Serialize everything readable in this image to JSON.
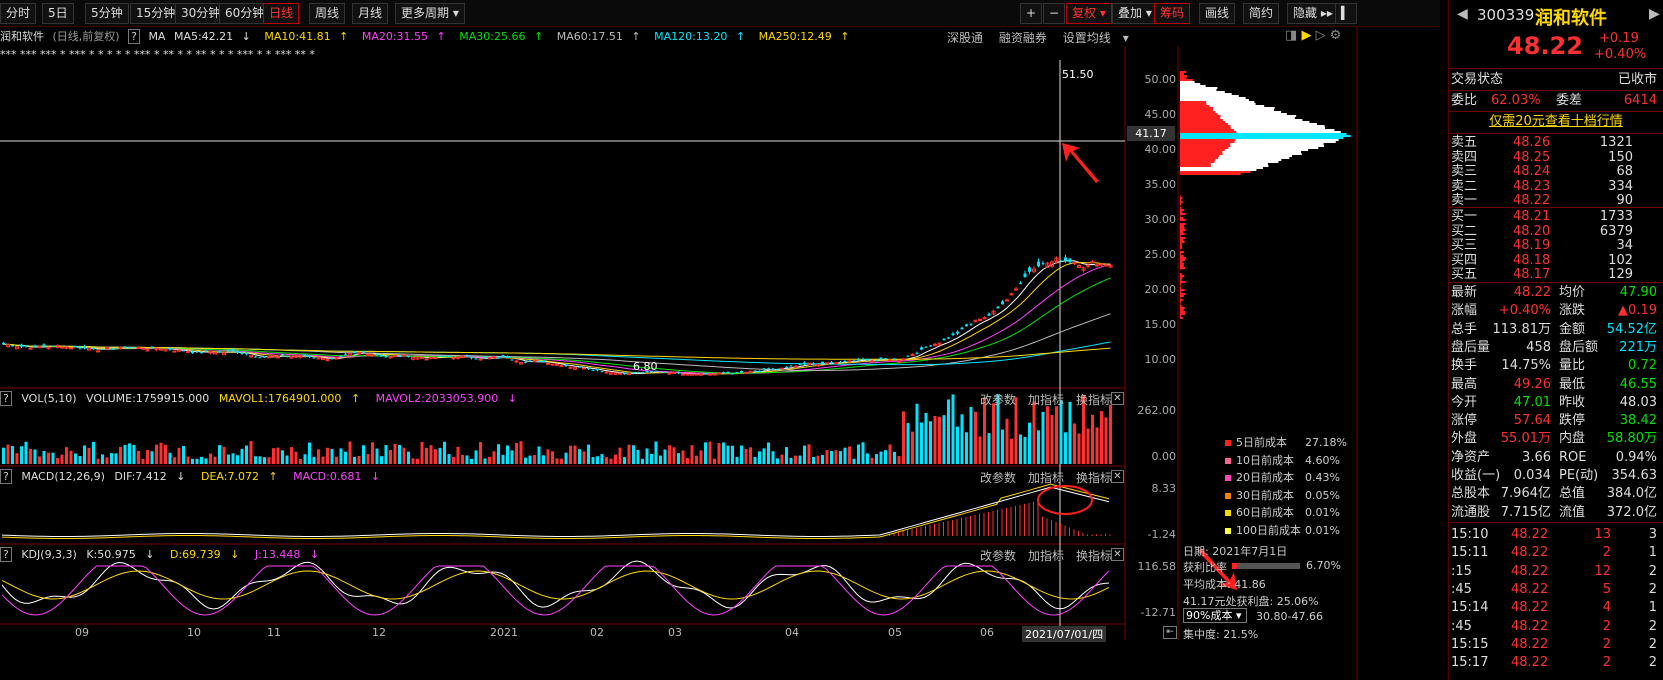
{
  "toolbar": {
    "tabs": [
      "分时",
      "5日",
      "5分钟",
      "15分钟",
      "30分钟",
      "60分钟",
      "日线",
      "周线",
      "月线",
      "更多周期"
    ],
    "right": [
      "+",
      "−",
      "复权",
      "叠加",
      "筹码",
      "画线",
      "简约",
      "隐藏"
    ]
  },
  "ma": {
    "name": "润和软件",
    "mode": "(日线,前复权)",
    "help": "?",
    "label": "MA",
    "ma5": "MA5:42.21",
    "ma10": "MA10:41.81",
    "ma20": "MA20:31.55",
    "ma30": "MA30:25.66",
    "ma60": "MA60:17.51",
    "ma120": "MA120:13.20",
    "ma250": "MA250:12.49"
  },
  "chart_links": [
    "深股通",
    "融资融券",
    "设置均线"
  ],
  "price_axis": [
    "50.00",
    "45.00",
    "40.00",
    "35.00",
    "30.00",
    "25.00",
    "20.00",
    "15.00",
    "10.00"
  ],
  "crosshair_price": "41.17",
  "peak_label": "51.50",
  "low_label": "6.80",
  "vol": {
    "label": "VOL(5,10)",
    "volume": "VOLUME:1759915.000",
    "mavol1": "MAVOL1:1764901.000",
    "mavol2": "MAVOL2:2033053.900",
    "axis_top": "262.00",
    "axis_bottom": "0.00"
  },
  "macd": {
    "label": "MACD(12,26,9)",
    "dif": "DIF:7.412",
    "dea": "DEA:7.072",
    "macd": "MACD:0.681",
    "axis_top": "8.33",
    "axis_bottom": "-1.24"
  },
  "kdj": {
    "label": "KDJ(9,3,3)",
    "k": "K:50.975",
    "d": "D:69.739",
    "j": "J:13.448",
    "axis_top": "116.58",
    "axis_bottom": "-12.71"
  },
  "ind_links": [
    "改参数",
    "加指标",
    "换指标"
  ],
  "time_axis": [
    "09",
    "10",
    "11",
    "12",
    "2021",
    "02",
    "03",
    "04",
    "05",
    "06"
  ],
  "time_cursor": "2021/07/01/四",
  "chips": {
    "legend": [
      {
        "label": "5日前成本",
        "value": "27.18%",
        "color": "#ff2020"
      },
      {
        "label": "10日前成本",
        "value": "4.60%",
        "color": "#ff6090"
      },
      {
        "label": "20日前成本",
        "value": "0.43%",
        "color": "#ff40c0"
      },
      {
        "label": "30日前成本",
        "value": "0.05%",
        "color": "#ff8000"
      },
      {
        "label": "60日前成本",
        "value": "0.01%",
        "color": "#ffd700"
      },
      {
        "label": "100日前成本",
        "value": "0.01%",
        "color": "#ffff40"
      }
    ],
    "date": "日期: 2021年7月1日",
    "profit_label": "获利比率",
    "profit_value": "6.70%",
    "avg_cost": "平均成本: 41.86",
    "profit_at": "41.17元处获利盘: 25.06%",
    "cost_select": "90%成本",
    "cost_range": "30.80-47.66",
    "concentration": "集中度: 21.5%"
  },
  "quote": {
    "code": "300339",
    "name": "润和软件",
    "price": "48.22",
    "chg": "+0.19",
    "pct": "+0.40%",
    "status_label": "交易状态",
    "status": "已收市",
    "wb_label": "委比",
    "wb": "62.03%",
    "wc_label": "委差",
    "wc": "6414",
    "level10": "仅需20元查看十档行情",
    "asks": [
      [
        "卖五",
        "48.26",
        "1321"
      ],
      [
        "卖四",
        "48.25",
        "150"
      ],
      [
        "卖三",
        "48.24",
        "68"
      ],
      [
        "卖二",
        "48.23",
        "334"
      ],
      [
        "卖一",
        "48.22",
        "90"
      ]
    ],
    "bids": [
      [
        "买一",
        "48.21",
        "1733"
      ],
      [
        "买二",
        "48.20",
        "6379"
      ],
      [
        "买三",
        "48.19",
        "34"
      ],
      [
        "买四",
        "48.18",
        "102"
      ],
      [
        "买五",
        "48.17",
        "129"
      ]
    ],
    "stats": [
      [
        "最新",
        "48.22",
        "r",
        "均价",
        "47.90",
        "g"
      ],
      [
        "涨幅",
        "+0.40%",
        "r",
        "涨跌",
        "▲0.19",
        "r"
      ],
      [
        "总手",
        "113.81万",
        "w",
        "金额",
        "54.52亿",
        "c"
      ],
      [
        "盘后量",
        "458",
        "w",
        "盘后额",
        "221万",
        "c"
      ],
      [
        "换手",
        "14.75%",
        "w",
        "量比",
        "0.72",
        "g"
      ],
      [
        "最高",
        "49.26",
        "r",
        "最低",
        "46.55",
        "g"
      ],
      [
        "今开",
        "47.01",
        "g",
        "昨收",
        "48.03",
        "w"
      ],
      [
        "涨停",
        "57.64",
        "r",
        "跌停",
        "38.42",
        "g"
      ],
      [
        "外盘",
        "55.01万",
        "r",
        "内盘",
        "58.80万",
        "g"
      ],
      [
        "净资产",
        "3.66",
        "w",
        "ROE",
        "0.94%",
        "w"
      ],
      [
        "收益(一)",
        "0.034",
        "w",
        "PE(动)",
        "354.63",
        "w"
      ],
      [
        "总股本",
        "7.964亿",
        "w",
        "总值",
        "384.0亿",
        "w"
      ],
      [
        "流通股",
        "7.715亿",
        "w",
        "流值",
        "372.0亿",
        "w"
      ]
    ],
    "ticks": [
      [
        "15:10",
        "48.22",
        "13",
        "3"
      ],
      [
        "15:11",
        "48.22",
        "2",
        "1"
      ],
      [
        ":15",
        "48.22",
        "12",
        "2"
      ],
      [
        ":45",
        "48.22",
        "5",
        "2"
      ],
      [
        "15:14",
        "48.22",
        "4",
        "1"
      ],
      [
        ":45",
        "48.22",
        "2",
        "2"
      ],
      [
        "15:15",
        "48.22",
        "2",
        "2"
      ],
      [
        "15:17",
        "48.22",
        "2",
        "2"
      ]
    ]
  }
}
